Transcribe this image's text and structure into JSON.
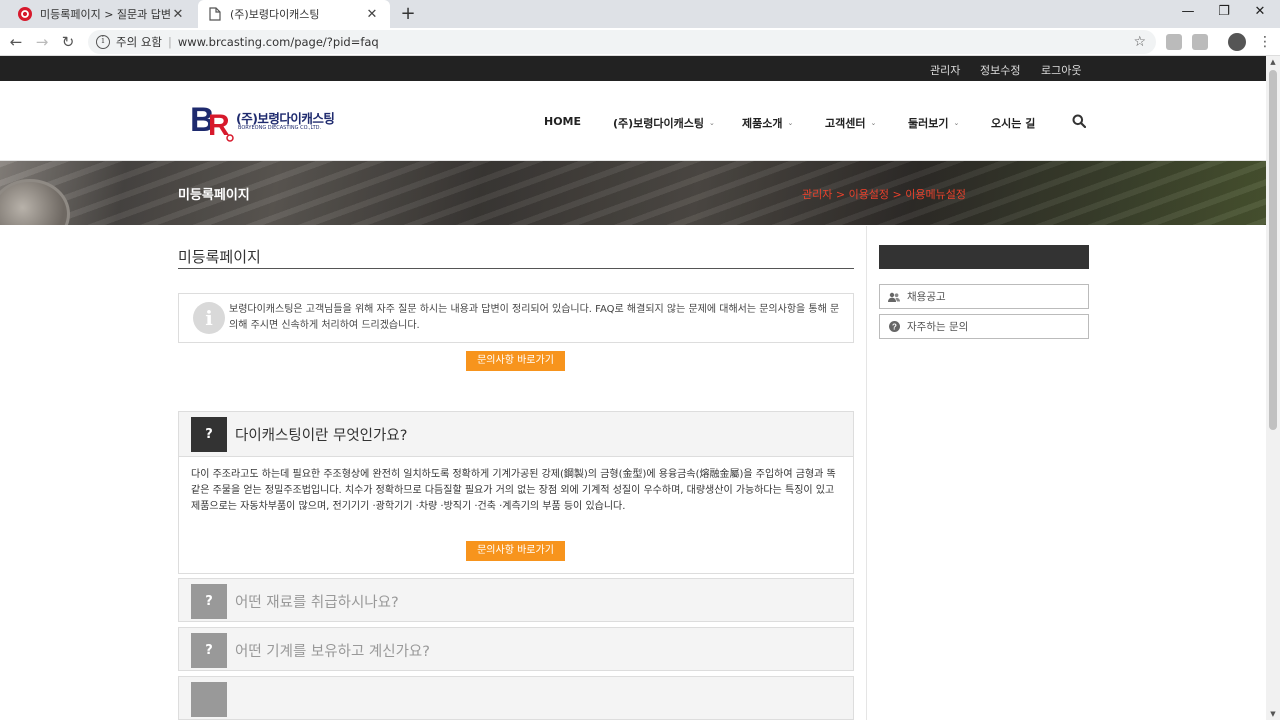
{
  "browser": {
    "tabs": [
      {
        "title": "미등록페이지 > 질문과 답변 | C",
        "active": false
      },
      {
        "title": "(주)보령다이캐스팅",
        "active": true
      }
    ],
    "address": {
      "security_label": "주의 요함",
      "separator": "|",
      "url": "www.brcasting.com/page/?pid=faq"
    },
    "new_tab_label": "+",
    "window_controls": {
      "minimize": "—",
      "restore": "❐",
      "close": "✕"
    }
  },
  "topbar": {
    "links": [
      "관리자",
      "정보수정",
      "로그아웃"
    ]
  },
  "logo": {
    "name": "(주)보령다이캐스팅",
    "english": "BORYEONG DIECASTING CO.,LTD."
  },
  "nav": {
    "items": [
      {
        "label": "HOME",
        "has_dropdown": false
      },
      {
        "label": "(주)보령다이캐스팅",
        "has_dropdown": true
      },
      {
        "label": "제품소개",
        "has_dropdown": true
      },
      {
        "label": "고객센터",
        "has_dropdown": true
      },
      {
        "label": "둘러보기",
        "has_dropdown": true
      },
      {
        "label": "오시는 길",
        "has_dropdown": false
      }
    ],
    "search_icon": "search-icon"
  },
  "banner": {
    "title": "미등록페이지",
    "breadcrumb": "관리자 > 이용설정 > 이용메뉴설정"
  },
  "main": {
    "title": "미등록페이지",
    "notice": "보령다이캐스팅은 고객님들을 위해 자주 질문 하시는 내용과 답변이 정리되어 있습니다. FAQ로 해결되지 않는 문제에 대해서는 문의사항을 통해 문의해 주시면 신속하게 처리하여 드리겠습니다.",
    "notice_button": "문의사항 바로가기",
    "faq": [
      {
        "q": "다이캐스팅이란 무엇인가요?",
        "expanded": true,
        "answer": "다이 주조라고도 하는데 필요한 주조형상에 완전히 일치하도록 정확하게 기계가공된 강제(鋼製)의 금형(金型)에 용융금속(熔融金屬)을 주입하여 금형과 똑같은 주물을 얻는 정밀주조법입니다. 치수가 정확하므로 다듬질할 필요가 거의 없는 장점 외에 기계적 성질이 우수하며, 대량생산이 가능하다는 특징이 있고 제품으로는 자동차부품이 많으며, 전기기기 ·광학기기 ·차량 ·방직기 ·건축 ·계측기의 부품 등이 있습니다.",
        "button": "문의사항 바로가기"
      },
      {
        "q": "어떤 재료를 취급하시나요?",
        "expanded": false
      },
      {
        "q": "어떤 기계를 보유하고 계신가요?",
        "expanded": false
      }
    ],
    "faq_mark": "?"
  },
  "sidebar": {
    "items": [
      {
        "label": "채용공고",
        "icon": "users-icon"
      },
      {
        "label": "자주하는 문의",
        "icon": "question-circle-icon"
      }
    ]
  },
  "colors": {
    "accent": "#f7941d",
    "breadcrumb": "#e8412c",
    "topbar": "#222222",
    "logo_blue": "#1e2a6e",
    "logo_red": "#d7192c"
  }
}
